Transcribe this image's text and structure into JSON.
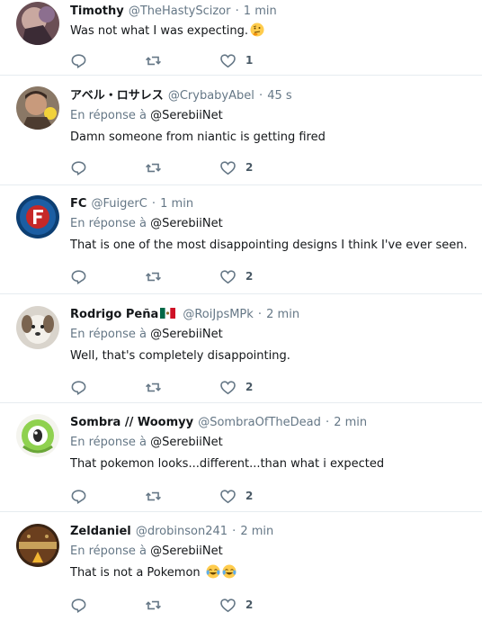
{
  "reply_prefix": "En réponse à",
  "tweets": [
    {
      "name": "Timothy",
      "handle": "@TheHastyScizor",
      "time": "1 min",
      "text": "Was not what I was expecting.",
      "emoji": "thinking-face",
      "like_count": "1"
    },
    {
      "name": "アベル・ロサレス",
      "handle": "@CrybabyAbel",
      "time": "45 s",
      "reply_to": "@SerebiiNet",
      "text": "Damn someone from niantic is getting fired",
      "like_count": "2"
    },
    {
      "name": "FC",
      "handle": "@FuigerC",
      "time": "1 min",
      "reply_to": "@SerebiiNet",
      "text": "That is one of the most disappointing designs I think I've ever seen.",
      "like_count": "2"
    },
    {
      "name": "Rodrigo Peña",
      "flag": "mexico-flag",
      "handle": "@RoiJpsMPk",
      "time": "2 min",
      "reply_to": "@SerebiiNet",
      "text": "Well, that's completely disappointing.",
      "like_count": "2"
    },
    {
      "name": "Sombra // Woomyy",
      "handle": "@SombraOfTheDead",
      "time": "2 min",
      "reply_to": "@SerebiiNet",
      "text": "That pokemon looks...different...than what i expected",
      "like_count": "2"
    },
    {
      "name": "Zeldaniel",
      "handle": "@drobinson241",
      "time": "2 min",
      "reply_to": "@SerebiiNet",
      "text": "That is not a Pokemon",
      "emoji": "tears-of-joy-faces",
      "like_count": "2"
    }
  ],
  "colors": {
    "meta_gray": "#657786",
    "text": "#14171a",
    "divider": "#e6ecf0"
  },
  "icons": {
    "reply": "reply-icon",
    "retweet": "retweet-icon",
    "like": "like-icon"
  }
}
